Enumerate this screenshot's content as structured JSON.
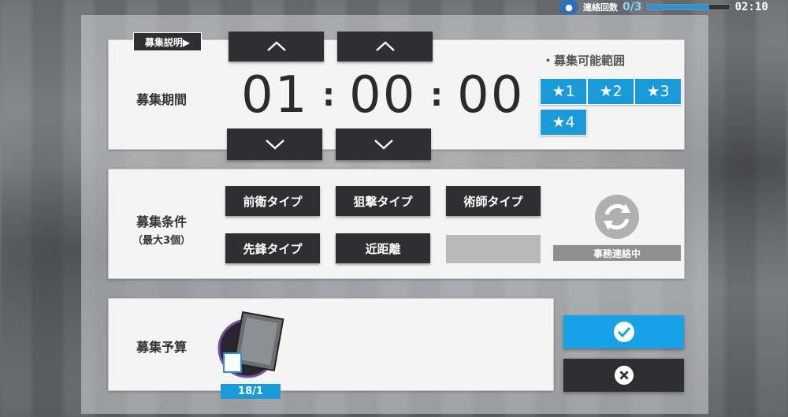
{
  "hud": {
    "label": "連絡回数",
    "count": "0/3",
    "time": "02:10",
    "bar_fill_fraction": 0.75
  },
  "explain_button": "募集説明▶",
  "duration": {
    "label": "募集期間",
    "hours": "01",
    "minutes": "00",
    "seconds": "00",
    "separator": ":"
  },
  "range": {
    "title": "・募集可能範囲",
    "stars": [
      "★1",
      "★2",
      "★3",
      "★4"
    ]
  },
  "conditions": {
    "label": "募集条件",
    "sublabel": "（最大3個）",
    "tags": [
      "前衛タイプ",
      "狙撃タイプ",
      "術師タイプ",
      "先鋒タイプ",
      "近距離"
    ],
    "status": "事務連絡中"
  },
  "budget": {
    "label": "募集予算",
    "item_count": "18/1"
  },
  "colors": {
    "accent": "#17a1e6",
    "dark_button": "#2f2f32"
  }
}
